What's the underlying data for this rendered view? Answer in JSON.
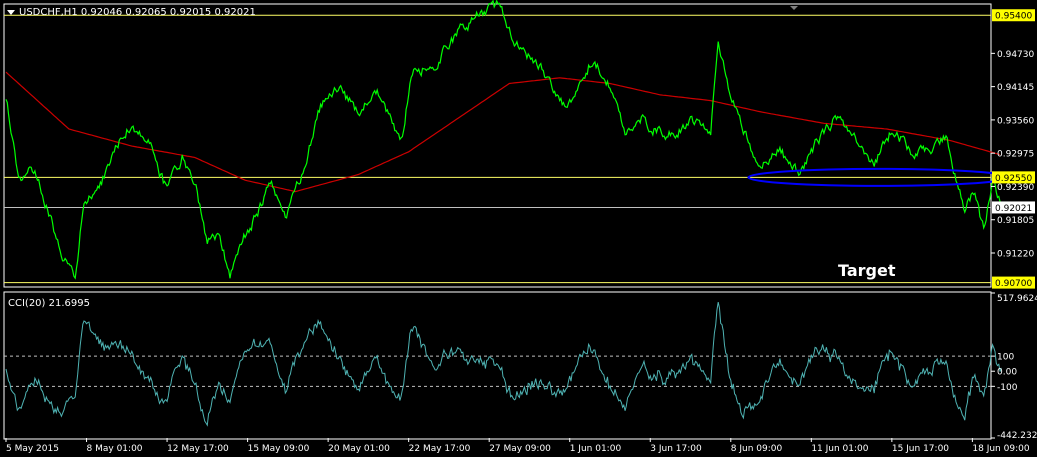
{
  "colors": {
    "background": "#000000",
    "panel_border": "#ffffff",
    "price": "#00ff00",
    "ma": "#cc0000",
    "cci": "#4fb3b3",
    "hline": "#ffff66",
    "highlight_ellipse": "#0000ff",
    "price_label_bg": "#ffff00"
  },
  "header": {
    "symbol_line": "USDCHF,H1  0.92046 0.92065 0.92015 0.92021",
    "menu_icon": "triangle-down-icon"
  },
  "annotation": {
    "target_label": "Target"
  },
  "cci_label": "CCI(20) 21.6995",
  "chart_data": [
    {
      "type": "line",
      "name_on_chart": "USDCHF,H1",
      "ylim": [
        0.9064,
        0.9558
      ],
      "y_ticks": [
        0.9473,
        0.94145,
        0.9356,
        0.92975,
        0.9239,
        0.91805,
        0.9122
      ],
      "highlighted_levels": [
        {
          "value": 0.954,
          "label": "0.95400"
        },
        {
          "value": 0.9255,
          "label": "0.92550"
        },
        {
          "value": 0.92021,
          "label": "0.92021"
        },
        {
          "value": 0.907,
          "label": "0.90700"
        }
      ],
      "x_tick_labels": [
        "5 May 2015",
        "8 May 01:00",
        "12 May 17:00",
        "15 May 09:00",
        "20 May 01:00",
        "22 May 17:00",
        "27 May 09:00",
        "1 Jun 01:00",
        "3 Jun 17:00",
        "8 Jun 09:00",
        "11 Jun 01:00",
        "15 Jun 17:00",
        "18 Jun 09:00"
      ],
      "x_tick_index": [
        0,
        64,
        128,
        192,
        256,
        320,
        384,
        448,
        512,
        576,
        640,
        704,
        768
      ],
      "n_points": 781,
      "price_anchors": [
        [
          0,
          0.94
        ],
        [
          10,
          0.925
        ],
        [
          20,
          0.928
        ],
        [
          30,
          0.922
        ],
        [
          45,
          0.912
        ],
        [
          55,
          0.9075
        ],
        [
          62,
          0.921
        ],
        [
          75,
          0.924
        ],
        [
          90,
          0.932
        ],
        [
          100,
          0.935
        ],
        [
          115,
          0.931
        ],
        [
          128,
          0.923
        ],
        [
          140,
          0.929
        ],
        [
          150,
          0.925
        ],
        [
          160,
          0.914
        ],
        [
          170,
          0.915
        ],
        [
          178,
          0.9085
        ],
        [
          188,
          0.9145
        ],
        [
          200,
          0.919
        ],
        [
          210,
          0.925
        ],
        [
          222,
          0.918
        ],
        [
          235,
          0.926
        ],
        [
          250,
          0.938
        ],
        [
          265,
          0.941
        ],
        [
          280,
          0.937
        ],
        [
          295,
          0.94
        ],
        [
          315,
          0.932
        ],
        [
          322,
          0.944
        ],
        [
          340,
          0.945
        ],
        [
          360,
          0.951
        ],
        [
          375,
          0.954
        ],
        [
          392,
          0.956
        ],
        [
          405,
          0.949
        ],
        [
          420,
          0.946
        ],
        [
          430,
          0.943
        ],
        [
          445,
          0.937
        ],
        [
          455,
          0.942
        ],
        [
          465,
          0.946
        ],
        [
          480,
          0.942
        ],
        [
          492,
          0.933
        ],
        [
          505,
          0.936
        ],
        [
          515,
          0.934
        ],
        [
          530,
          0.933
        ],
        [
          545,
          0.936
        ],
        [
          560,
          0.934
        ],
        [
          566,
          0.95
        ],
        [
          575,
          0.94
        ],
        [
          590,
          0.932
        ],
        [
          600,
          0.927
        ],
        [
          615,
          0.93
        ],
        [
          630,
          0.926
        ],
        [
          645,
          0.932
        ],
        [
          660,
          0.936
        ],
        [
          675,
          0.933
        ],
        [
          690,
          0.928
        ],
        [
          705,
          0.934
        ],
        [
          720,
          0.93
        ],
        [
          735,
          0.93
        ],
        [
          748,
          0.933
        ],
        [
          755,
          0.925
        ],
        [
          762,
          0.92
        ],
        [
          770,
          0.923
        ],
        [
          777,
          0.916
        ],
        [
          784,
          0.925
        ],
        [
          791,
          0.921
        ]
      ],
      "ma_anchors": [
        [
          0,
          0.944
        ],
        [
          50,
          0.934
        ],
        [
          100,
          0.931
        ],
        [
          150,
          0.929
        ],
        [
          190,
          0.925
        ],
        [
          230,
          0.923
        ],
        [
          280,
          0.926
        ],
        [
          320,
          0.93
        ],
        [
          360,
          0.936
        ],
        [
          400,
          0.942
        ],
        [
          440,
          0.943
        ],
        [
          480,
          0.942
        ],
        [
          520,
          0.94
        ],
        [
          560,
          0.939
        ],
        [
          600,
          0.937
        ],
        [
          650,
          0.935
        ],
        [
          700,
          0.934
        ],
        [
          750,
          0.932
        ],
        [
          790,
          0.9295
        ]
      ],
      "highlight": {
        "x_from": 590,
        "x_to": 798,
        "y_center": 0.9255,
        "y_half_height": 0.0015
      }
    },
    {
      "type": "line",
      "name_on_chart": "CCI(20)",
      "current_value": 21.6995,
      "ylim": [
        -442.2327,
        517.9624
      ],
      "y_tick_labels": [
        "517.9624",
        "100",
        "0.00",
        "-100",
        "-442.2327"
      ],
      "y_tick_values": [
        517.9624,
        100,
        0,
        -100,
        -442.2327
      ],
      "dashed_levels": [
        100,
        -100
      ]
    }
  ]
}
